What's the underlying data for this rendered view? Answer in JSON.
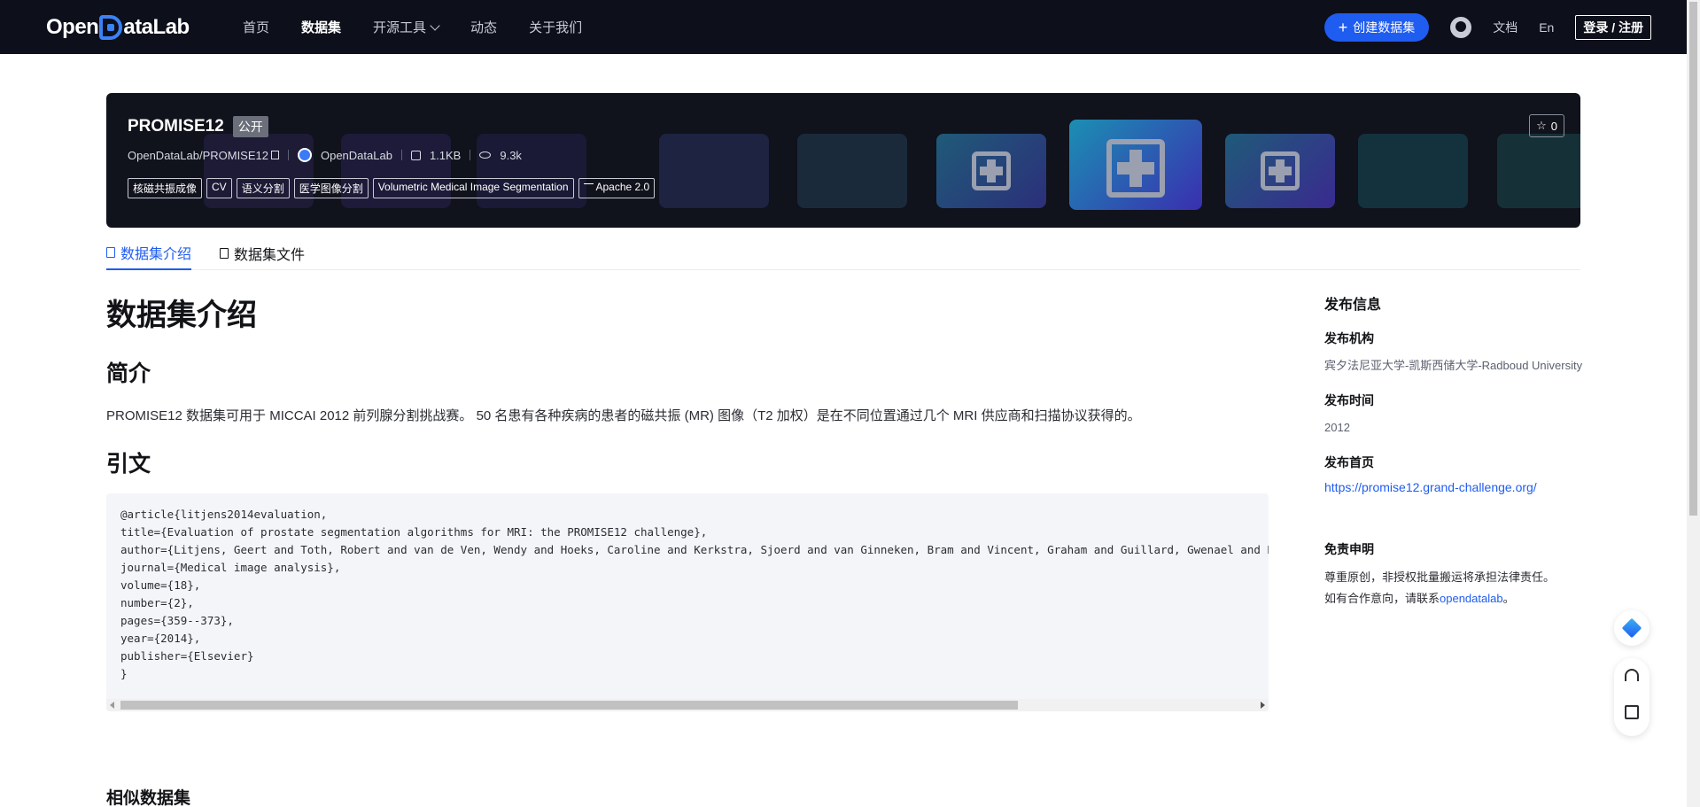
{
  "nav": {
    "logo_prefix": "Open",
    "logo_suffix": "ataLab",
    "items": [
      {
        "label": "首页"
      },
      {
        "label": "数据集"
      },
      {
        "label": "开源工具"
      },
      {
        "label": "动态"
      },
      {
        "label": "关于我们"
      }
    ],
    "create_label": "创建数据集",
    "docs_label": "文档",
    "lang_label": "En",
    "login_label": "登录 / 注册"
  },
  "banner": {
    "name": "PROMISE12",
    "visibility": "公开",
    "path": "OpenDataLab/PROMISE12",
    "org": "OpenDataLab",
    "size": "1.1KB",
    "views": "9.3k",
    "stars": "0",
    "tags": [
      "核磁共振成像",
      "CV",
      "语义分割",
      "医学图像分割",
      "Volumetric Medical Image Segmentation"
    ],
    "license": "Apache 2.0"
  },
  "tabs": [
    {
      "label": "数据集介绍"
    },
    {
      "label": "数据集文件"
    }
  ],
  "content": {
    "title": "数据集介绍",
    "intro_heading": "简介",
    "intro_text": "PROMISE12 数据集可用于 MICCAI 2012 前列腺分割挑战赛。 50 名患有各种疾病的患者的磁共振 (MR) 图像（T2 加权）是在不同位置通过几个 MRI 供应商和扫描协议获得的。",
    "citation_heading": "引文",
    "citation": "@article{litjens2014evaluation,\ntitle={Evaluation of prostate segmentation algorithms for MRI: the PROMISE12 challenge},\nauthor={Litjens, Geert and Toth, Robert and van de Ven, Wendy and Hoeks, Caroline and Kerkstra, Sjoerd and van Ginneken, Bram and Vincent, Graham and Guillard, Gwenael and B\njournal={Medical image analysis},\nvolume={18},\nnumber={2},\npages={359--373},\nyear={2014},\npublisher={Elsevier}\n}",
    "similar_heading": "相似数据集"
  },
  "sidebar": {
    "heading": "发布信息",
    "org_label": "发布机构",
    "org_value": "宾夕法尼亚大学-凯斯西储大学-Radboud University",
    "time_label": "发布时间",
    "time_value": "2012",
    "home_label": "发布首页",
    "home_url": "https://promise12.grand-challenge.org/",
    "disclaimer_label": "免责申明",
    "disclaimer_line1": "尊重原创，非授权批量搬运将承担法律责任。",
    "disclaimer_line2_prefix": "如有合作意向，请联系",
    "disclaimer_link": "opendatalab",
    "disclaimer_line2_suffix": "。"
  },
  "icons": {
    "create": "plus-icon",
    "github": "github-icon",
    "star": "star-icon",
    "copy": "copy-icon",
    "size": "disk-icon",
    "views": "eye-icon",
    "license": "scale-icon",
    "back_to_top": "diamond-icon",
    "support": "headset-icon",
    "feedback": "edit-icon"
  },
  "colors": {
    "accent": "#1f5cf0",
    "topbar": "#0d0f1a",
    "banner": "#10121c"
  }
}
